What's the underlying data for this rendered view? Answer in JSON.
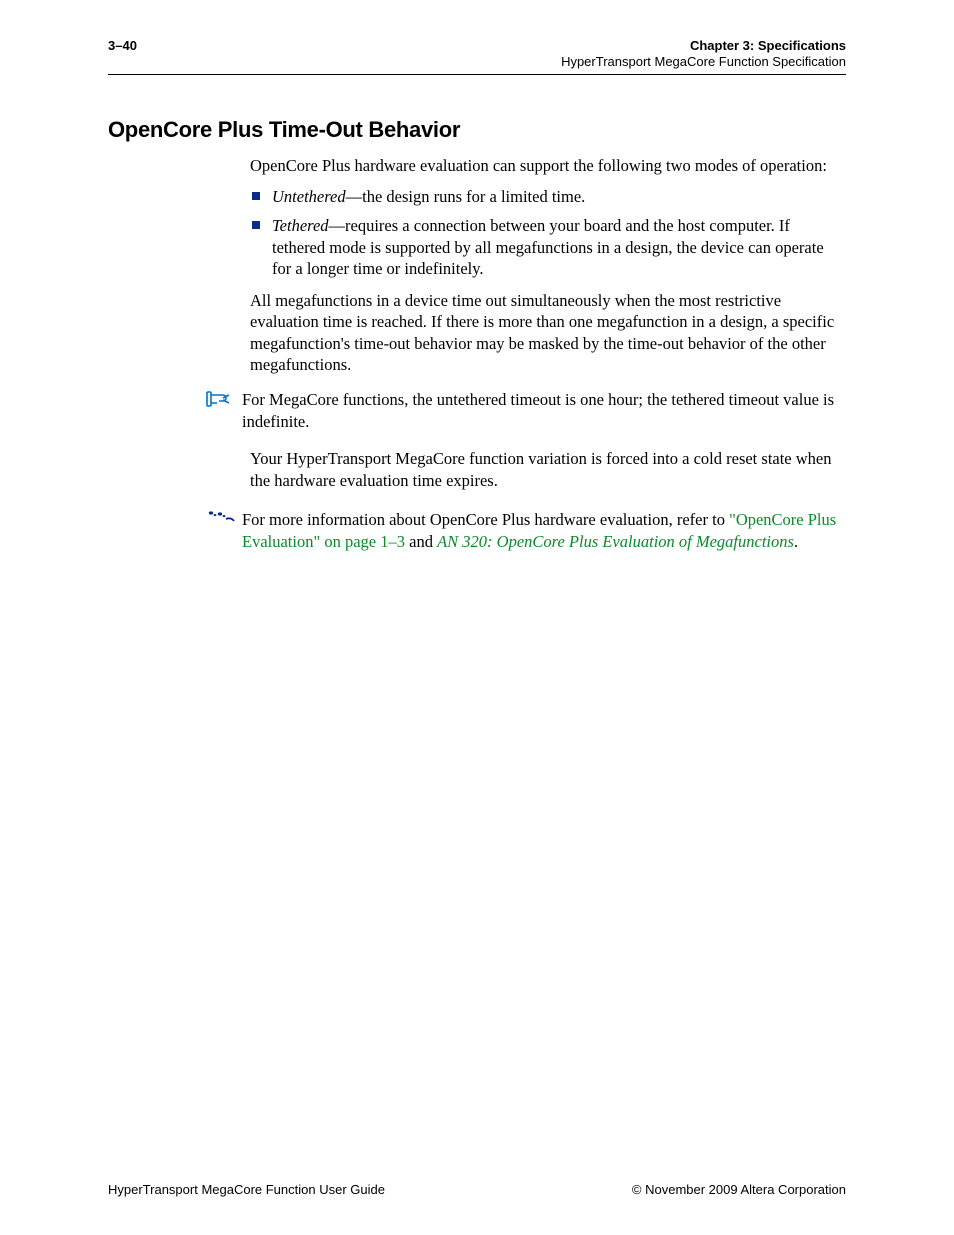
{
  "header": {
    "page_no": "3–40",
    "chapter_label": "Chapter 3:  Specifications",
    "chapter_sub": "HyperTransport MegaCore Function Specification"
  },
  "section_heading": "OpenCore Plus Time-Out Behavior",
  "intro": "OpenCore Plus hardware evaluation can support the following two modes of operation:",
  "bullets": [
    {
      "term": "Untethered",
      "rest": "—the design runs for a limited time."
    },
    {
      "term": "Tethered",
      "rest": "—requires a connection between your board and the host computer. If tethered mode is supported by all megafunctions in a design, the device can operate for a longer time or indefinitely."
    }
  ],
  "para_timeout": "All megafunctions in a device time out simultaneously when the most restrictive evaluation time is reached. If there is more than one megafunction in a design, a specific megafunction's time-out behavior may be masked by the time-out behavior of the other megafunctions.",
  "note_text": "For MegaCore functions, the untethered timeout is one hour; the tethered timeout value is indefinite.",
  "para_reset": "Your HyperTransport MegaCore function variation is forced into a cold reset state when the hardware evaluation time expires.",
  "xref_prefix": "For more information about OpenCore Plus hardware evaluation, refer to ",
  "xref_link1": "\"OpenCore Plus Evaluation\" on page 1–3",
  "xref_and": " and ",
  "xref_link2": "AN 320: OpenCore Plus Evaluation of Megafunctions",
  "xref_suffix": ".",
  "footer": {
    "left": "HyperTransport MegaCore Function User Guide",
    "right": "© November 2009   Altera Corporation"
  }
}
